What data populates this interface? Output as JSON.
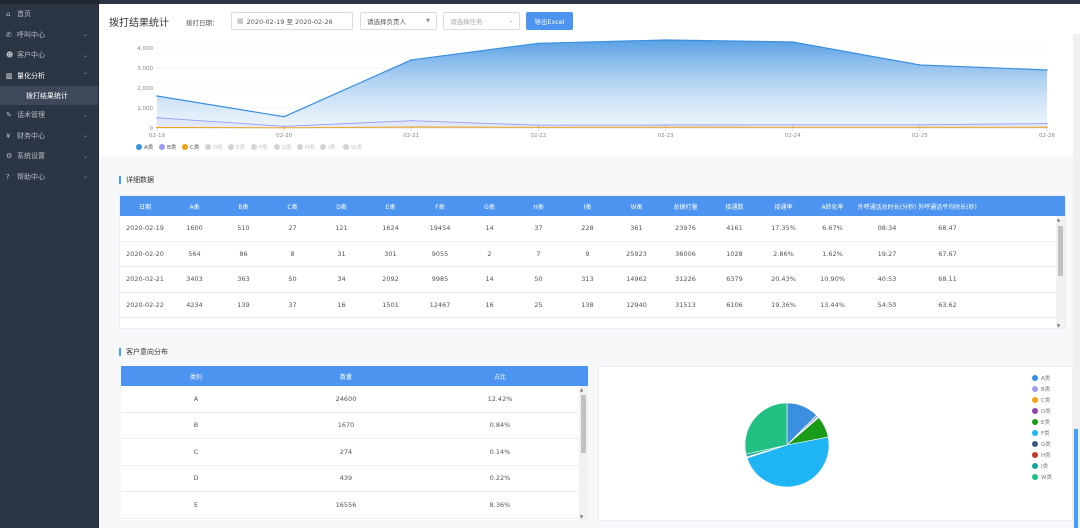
{
  "sidebar": {
    "items": [
      {
        "label": "首页",
        "icon": "home-icon",
        "glyph": "⌂",
        "has_chevron": false
      },
      {
        "label": "呼叫中心",
        "icon": "phone-icon",
        "glyph": "✆",
        "has_chevron": true
      },
      {
        "label": "客户中心",
        "icon": "user-icon",
        "glyph": "☻",
        "has_chevron": true
      },
      {
        "label": "量化分析",
        "icon": "chart-icon",
        "glyph": "▥",
        "has_chevron": true,
        "active": true
      }
    ],
    "sub_item": "拨打结果统计",
    "items_after": [
      {
        "label": "话术管理",
        "icon": "script-icon",
        "glyph": "✎",
        "has_chevron": true
      },
      {
        "label": "财务中心",
        "icon": "wallet-icon",
        "glyph": "¥",
        "has_chevron": true
      },
      {
        "label": "系统设置",
        "icon": "gear-icon",
        "glyph": "⚙",
        "has_chevron": true
      },
      {
        "label": "帮助中心",
        "icon": "help-icon",
        "glyph": "?",
        "has_chevron": true
      }
    ]
  },
  "toolbar": {
    "title": "拨打结果统计",
    "date_label": "拨打日期：",
    "date_range": "2020-02-19 至 2020-02-26",
    "owner_select": "请选择负责人",
    "task_select_placeholder": "请选择任务",
    "export_label": "导出Excel"
  },
  "chart_data": {
    "type": "area",
    "categories": [
      "02-19",
      "02-20",
      "02-21",
      "02-22",
      "02-23",
      "02-24",
      "02-25",
      "02-26"
    ],
    "ylim": [
      0,
      4000
    ],
    "yticks": [
      "4,000",
      "3,000",
      "2,000",
      "1,000",
      "0"
    ],
    "series": [
      {
        "name": "A类",
        "values": [
          1600,
          564,
          3403,
          4234,
          4400,
          4300,
          3150,
          2900
        ],
        "color": "#3b8fdf"
      },
      {
        "name": "B类",
        "values": [
          510,
          86,
          363,
          139,
          150,
          160,
          160,
          220
        ],
        "color": "#9a9df0"
      },
      {
        "name": "C类",
        "values": [
          27,
          8,
          50,
          37,
          40,
          40,
          40,
          40
        ],
        "color": "#f0a20f"
      }
    ],
    "legend_inactive": [
      "D类",
      "E类",
      "F类",
      "G类",
      "H类",
      "I类",
      "W类"
    ],
    "legend_position": "bottom-left",
    "grid": true
  },
  "detail": {
    "section_title": "详细数据",
    "columns": [
      "日期",
      "A类",
      "B类",
      "C类",
      "D类",
      "E类",
      "F类",
      "G类",
      "H类",
      "I类",
      "W类",
      "总拨打量",
      "接通数",
      "接通率",
      "A转化率",
      "外呼通话总时长(分秒)",
      "外呼通话平均时长(秒)"
    ],
    "rows": [
      [
        "2020-02-19",
        "1600",
        "510",
        "27",
        "121",
        "1624",
        "19454",
        "14",
        "37",
        "228",
        "361",
        "23976",
        "4161",
        "17.35%",
        "6.67%",
        "08:34",
        "68.47"
      ],
      [
        "2020-02-20",
        "564",
        "86",
        "8",
        "31",
        "301",
        "9055",
        "2",
        "7",
        "9",
        "25923",
        "36006",
        "1028",
        "2.86%",
        "1.62%",
        "19:27",
        "67.67"
      ],
      [
        "2020-02-21",
        "3403",
        "363",
        "50",
        "34",
        "2092",
        "9985",
        "14",
        "50",
        "313",
        "14962",
        "31226",
        "6379",
        "20.43%",
        "10.90%",
        "40:53",
        "68.11"
      ],
      [
        "2020-02-22",
        "4234",
        "139",
        "37",
        "16",
        "1501",
        "12467",
        "16",
        "25",
        "138",
        "12940",
        "31513",
        "6106",
        "19.36%",
        "13.44%",
        "54:50",
        "63.62"
      ]
    ]
  },
  "distribution": {
    "section_title": "客户意向分布",
    "columns": [
      "类别",
      "数量",
      "占比"
    ],
    "rows": [
      [
        "A",
        "24600",
        "12.42%"
      ],
      [
        "B",
        "1670",
        "0.84%"
      ],
      [
        "C",
        "274",
        "0.14%"
      ],
      [
        "D",
        "439",
        "0.22%"
      ],
      [
        "E",
        "16556",
        "8.36%"
      ]
    ]
  },
  "pie": {
    "legend": [
      {
        "name": "A类",
        "color": "#3b8fdf"
      },
      {
        "name": "B类",
        "color": "#9a9df0"
      },
      {
        "name": "C类",
        "color": "#f0a20f"
      },
      {
        "name": "D类",
        "color": "#8e44ad"
      },
      {
        "name": "E类",
        "color": "#1a9c1a"
      },
      {
        "name": "F类",
        "color": "#1fb5f5"
      },
      {
        "name": "G类",
        "color": "#3d5a80"
      },
      {
        "name": "H类",
        "color": "#c0392b"
      },
      {
        "name": "I类",
        "color": "#16a6a0"
      },
      {
        "name": "W类",
        "color": "#22c183"
      }
    ],
    "values": [
      12.42,
      0.84,
      0.14,
      0.22,
      8.36,
      48,
      0.2,
      0.3,
      1.0,
      28.5
    ]
  },
  "colors": {
    "accent": "#4d94f0",
    "sidebar_bg": "#2c3544"
  }
}
